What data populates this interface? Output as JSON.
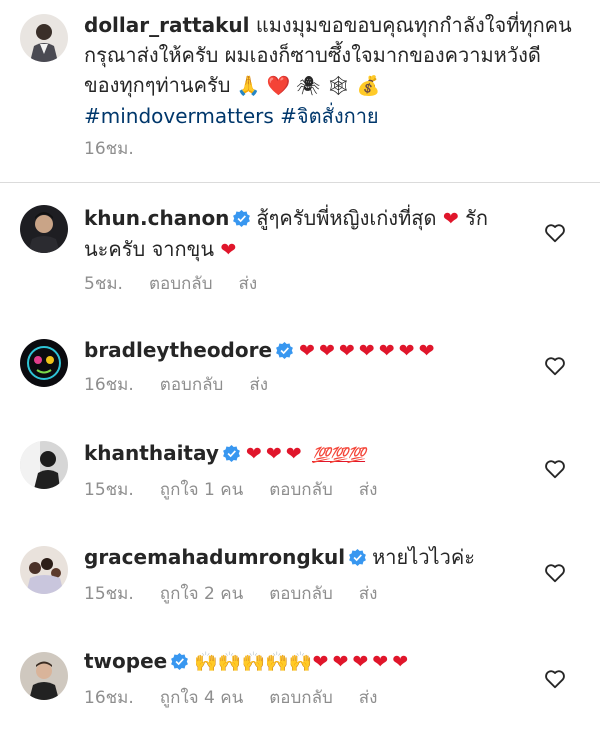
{
  "post": {
    "username": "dollar_rattakul",
    "text_line1": "แมงมุมขอขอบคุณทุกกำลังใจที่ทุกคน",
    "text_line2": "กรุณาส่งให้ครับ ผมเองก็ซาบซึ้งใจมากของความหวังดี",
    "text_line3": "ของทุกๆท่านครับ",
    "emojis": "🙏 ❤️ 🕷 🕸 💰",
    "hashtags": [
      "#mindovermatters",
      "#จิตสั่งกาย"
    ],
    "time": "16ชม."
  },
  "labels": {
    "reply": "ตอบกลับ",
    "send": "ส่ง"
  },
  "comments": [
    {
      "username": "khun.chanon",
      "verified": true,
      "text_line1": "สู้ๆครับพี่หญิงเก่งที่สุด",
      "text_line1_end": "รัก",
      "text_line2": "นะครับ จากขุน",
      "time": "5ชม.",
      "likes": ""
    },
    {
      "username": "bradleytheodore",
      "verified": true,
      "emoji_text": "❤❤❤❤❤❤❤",
      "time": "16ชม.",
      "likes": ""
    },
    {
      "username": "khanthaitay",
      "verified": true,
      "emoji_text": "❤❤❤",
      "extra": "💯💯💯",
      "time": "15ชม.",
      "likes": "ถูกใจ 1 คน"
    },
    {
      "username": "gracemahadumrongkul",
      "verified": true,
      "text": "หายไวไวค่ะ",
      "time": "15ชม.",
      "likes": "ถูกใจ 2 คน"
    },
    {
      "username": "twopee",
      "verified": true,
      "emoji_text": "🙌🙌🙌🙌🙌",
      "emoji_text2": "❤❤❤❤❤",
      "time": "16ชม.",
      "likes": "ถูกใจ 4 คน"
    }
  ]
}
